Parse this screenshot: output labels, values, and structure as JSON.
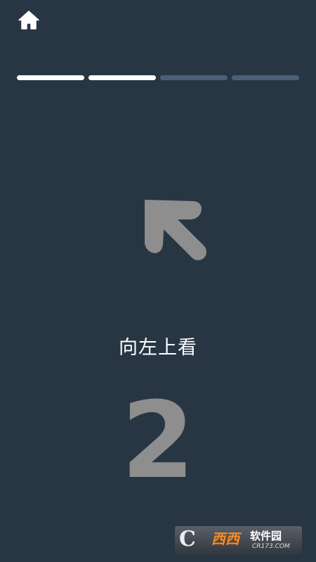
{
  "colors": {
    "background": "#283644",
    "progress_done": "#ffffff",
    "progress_pending": "#4b6076",
    "arrow": "#8e8e8e",
    "countdown": "#8e8e8e",
    "text": "#ffffff"
  },
  "header": {
    "home_icon": "home-icon"
  },
  "progress": {
    "total_steps": 4,
    "completed_steps": 2
  },
  "direction": {
    "arrow_icon": "arrow-up-left-icon",
    "instruction": "向左上看"
  },
  "countdown": {
    "value": "2"
  },
  "watermark": {
    "logo_text": "西西",
    "name": "软件园",
    "url": "CR173.COM"
  }
}
